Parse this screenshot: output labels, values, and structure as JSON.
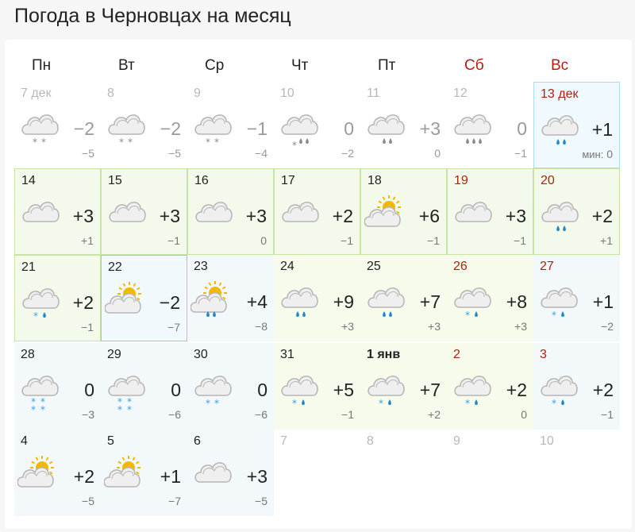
{
  "title": "Погода в Черновцах на месяц",
  "weekdays": [
    {
      "label": "Пн",
      "weekend": false
    },
    {
      "label": "Вт",
      "weekend": false
    },
    {
      "label": "Ср",
      "weekend": false
    },
    {
      "label": "Чт",
      "weekend": false
    },
    {
      "label": "Пт",
      "weekend": false
    },
    {
      "label": "Сб",
      "weekend": true
    },
    {
      "label": "Вс",
      "weekend": true
    }
  ],
  "colors": {
    "weekend": "#b3200f",
    "sun": "#f5b800",
    "rain": "#1e88c8",
    "snow": "#3aa0e0"
  },
  "min_label": "мин:",
  "days": [
    {
      "date": "7 дек",
      "max": "−2",
      "min": "−5",
      "icon": "cloud-snow-icon",
      "state": "past"
    },
    {
      "date": "8",
      "max": "−2",
      "min": "−5",
      "icon": "cloud-snow-icon",
      "state": "past"
    },
    {
      "date": "9",
      "max": "−1",
      "min": "−4",
      "icon": "cloud-snow-icon",
      "state": "past"
    },
    {
      "date": "10",
      "max": "0",
      "min": "−2",
      "icon": "cloud-sleet-icon",
      "state": "past"
    },
    {
      "date": "11",
      "max": "+3",
      "min": "0",
      "icon": "cloud-rain-icon",
      "state": "past"
    },
    {
      "date": "12",
      "max": "0",
      "min": "−1",
      "icon": "cloud-heavy-rain-icon",
      "state": "past"
    },
    {
      "date": "13 дек",
      "max": "+1",
      "min": "0",
      "icon": "cloud-rain-icon",
      "state": "today"
    },
    {
      "date": "14",
      "max": "+3",
      "min": "+1",
      "icon": "cloud-icon",
      "state": "hl"
    },
    {
      "date": "15",
      "max": "+3",
      "min": "−1",
      "icon": "cloud-icon",
      "state": "hl"
    },
    {
      "date": "16",
      "max": "+3",
      "min": "0",
      "icon": "cloud-icon",
      "state": "hl"
    },
    {
      "date": "17",
      "max": "+2",
      "min": "−1",
      "icon": "cloud-icon",
      "state": "hl"
    },
    {
      "date": "18",
      "max": "+6",
      "min": "−1",
      "icon": "sun-cloud-icon",
      "state": "hl"
    },
    {
      "date": "19",
      "max": "+3",
      "min": "−1",
      "icon": "cloud-icon",
      "state": "hl"
    },
    {
      "date": "20",
      "max": "+2",
      "min": "+1",
      "icon": "cloud-rain-icon",
      "state": "hl"
    },
    {
      "date": "21",
      "max": "+2",
      "min": "−1",
      "icon": "cloud-snow-rain-icon",
      "state": "hl"
    },
    {
      "date": "22",
      "max": "−2",
      "min": "−7",
      "icon": "sun-cloud-icon",
      "state": "sel"
    },
    {
      "date": "23",
      "max": "+4",
      "min": "−8",
      "icon": "sun-cloud-rain-icon",
      "state": "cool"
    },
    {
      "date": "24",
      "max": "+9",
      "min": "+3",
      "icon": "cloud-rain-icon",
      "state": "warm"
    },
    {
      "date": "25",
      "max": "+7",
      "min": "+3",
      "icon": "cloud-rain-icon",
      "state": "warm"
    },
    {
      "date": "26",
      "max": "+8",
      "min": "+3",
      "icon": "cloud-snow-rain-icon",
      "state": "warm"
    },
    {
      "date": "27",
      "max": "+1",
      "min": "−2",
      "icon": "cloud-snow-rain-icon",
      "state": "cool"
    },
    {
      "date": "28",
      "max": "0",
      "min": "−3",
      "icon": "cloud-heavy-snow-icon",
      "state": "cool"
    },
    {
      "date": "29",
      "max": "0",
      "min": "−6",
      "icon": "cloud-heavy-snow-icon",
      "state": "cool"
    },
    {
      "date": "30",
      "max": "0",
      "min": "−6",
      "icon": "cloud-snow-icon-blue",
      "state": "cool"
    },
    {
      "date": "31",
      "max": "+5",
      "min": "−1",
      "icon": "cloud-snow-rain-icon",
      "state": "warm"
    },
    {
      "date": "1 янв",
      "max": "+7",
      "min": "+2",
      "icon": "cloud-snow-rain-icon",
      "state": "warm"
    },
    {
      "date": "2",
      "max": "+2",
      "min": "0",
      "icon": "cloud-snow-rain-icon",
      "state": "warm"
    },
    {
      "date": "3",
      "max": "+2",
      "min": "−1",
      "icon": "cloud-snow-rain-icon",
      "state": "cool"
    },
    {
      "date": "4",
      "max": "+2",
      "min": "−5",
      "icon": "sun-cloud-icon",
      "state": "cool"
    },
    {
      "date": "5",
      "max": "+1",
      "min": "−7",
      "icon": "sun-cloud-icon",
      "state": "cool"
    },
    {
      "date": "6",
      "max": "+3",
      "min": "−5",
      "icon": "cloud-icon",
      "state": "cool"
    },
    {
      "date": "7",
      "max": "",
      "min": "",
      "icon": "",
      "state": "empty"
    },
    {
      "date": "8",
      "max": "",
      "min": "",
      "icon": "",
      "state": "empty"
    },
    {
      "date": "9",
      "max": "",
      "min": "",
      "icon": "",
      "state": "empty"
    },
    {
      "date": "10",
      "max": "",
      "min": "",
      "icon": "",
      "state": "empty"
    }
  ]
}
